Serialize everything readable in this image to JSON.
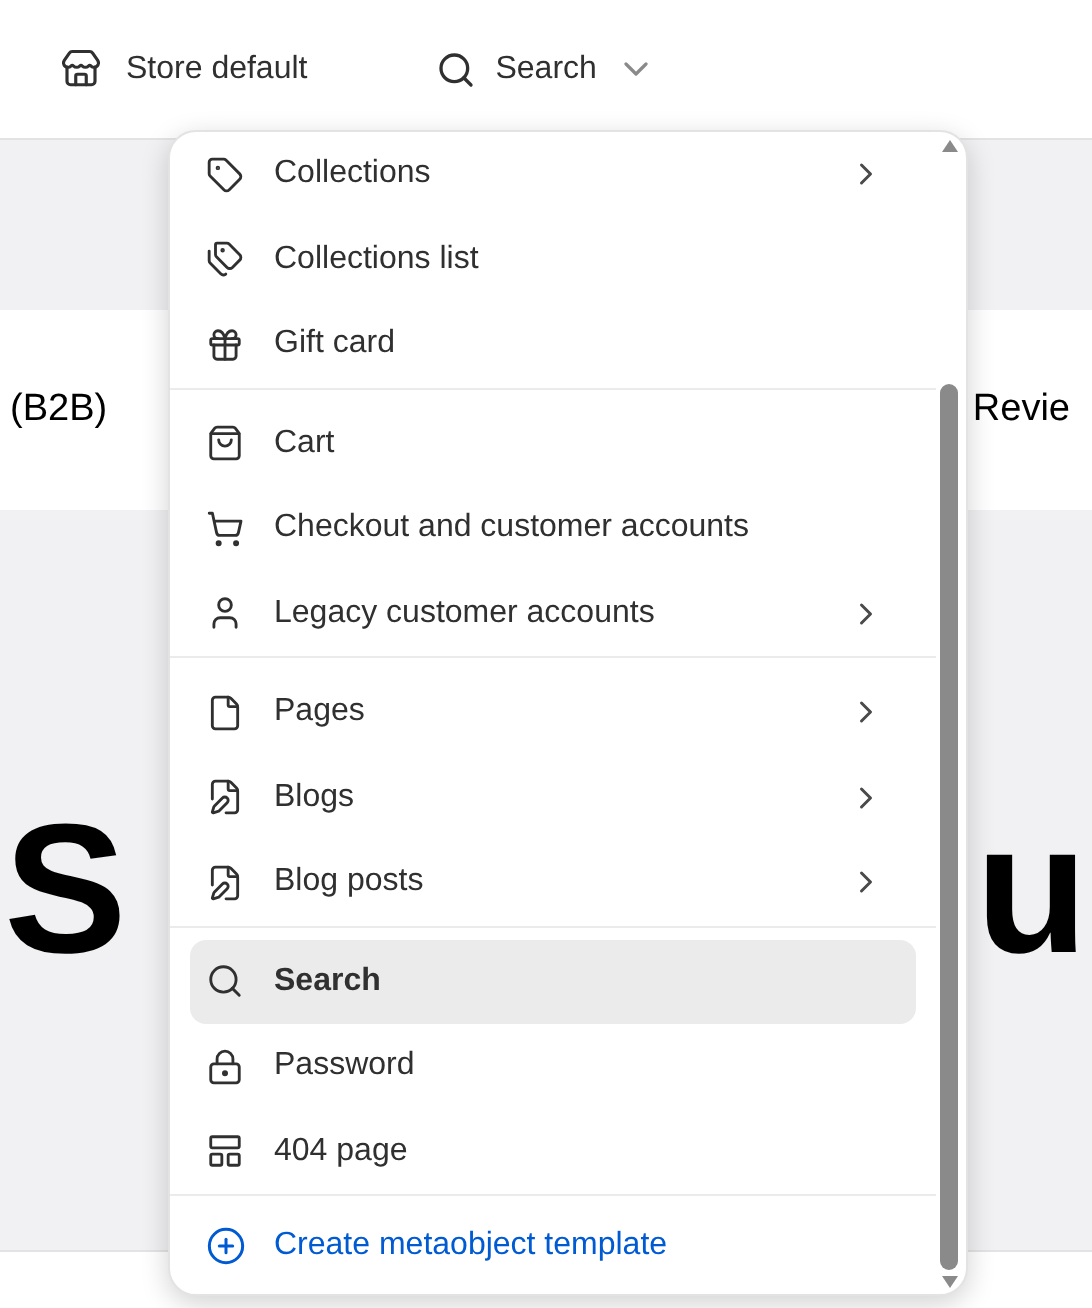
{
  "header": {
    "store": {
      "label": "Store default"
    },
    "template_picker": {
      "label": "Search",
      "expanded": true
    }
  },
  "background": {
    "band_left": "(B2B)",
    "band_right": "Revie",
    "heading_left": "S",
    "heading_right": "u"
  },
  "menu": {
    "groups": [
      {
        "items": [
          {
            "label": "Collections",
            "submenu": true,
            "selected": false
          },
          {
            "label": "Collections list",
            "submenu": false,
            "selected": false
          },
          {
            "label": "Gift card",
            "submenu": false,
            "selected": false
          }
        ]
      },
      {
        "items": [
          {
            "label": "Cart",
            "submenu": false,
            "selected": false
          },
          {
            "label": "Checkout and customer accounts",
            "submenu": false,
            "selected": false
          },
          {
            "label": "Legacy customer accounts",
            "submenu": true,
            "selected": false
          }
        ]
      },
      {
        "items": [
          {
            "label": "Pages",
            "submenu": true,
            "selected": false
          },
          {
            "label": "Blogs",
            "submenu": true,
            "selected": false
          },
          {
            "label": "Blog posts",
            "submenu": true,
            "selected": false
          }
        ]
      },
      {
        "items": [
          {
            "label": "Search",
            "submenu": false,
            "selected": true
          },
          {
            "label": "Password",
            "submenu": false,
            "selected": false
          },
          {
            "label": "404 page",
            "submenu": false,
            "selected": false
          }
        ]
      }
    ],
    "action": {
      "label": "Create metaobject template"
    }
  }
}
